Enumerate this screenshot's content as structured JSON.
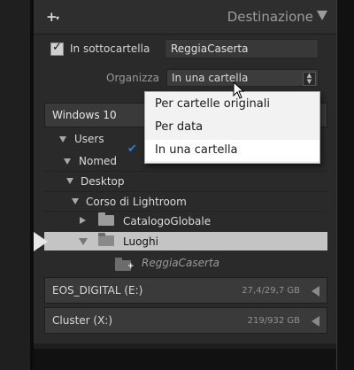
{
  "header": {
    "title": "Destinazione",
    "add_icon": "plus-icon",
    "collapse_icon": "triangle-down-icon"
  },
  "subfolder": {
    "label": "In sottocartella",
    "checked": true,
    "value": "ReggiaCaserta"
  },
  "organize": {
    "label": "Organizza",
    "value": "In una cartella"
  },
  "dropdown": {
    "items": [
      {
        "label": "Per cartelle originali",
        "selected": false
      },
      {
        "label": "Per data",
        "selected": false
      },
      {
        "label": "In una cartella",
        "selected": true
      }
    ],
    "check_color": "#2c7fd6"
  },
  "tree": {
    "volume_main": "Windows 10",
    "items": [
      {
        "label": "Users"
      },
      {
        "label": "Nomed"
      },
      {
        "label": "Desktop"
      },
      {
        "label": "Corso di Lightroom"
      },
      {
        "label": "CatalogoGlobale"
      },
      {
        "label": "Luoghi"
      },
      {
        "label": "ReggiaCaserta"
      }
    ]
  },
  "volumes": [
    {
      "name": "EOS_DIGITAL (E:)",
      "size": "27,4/29,7 GB"
    },
    {
      "name": "Cluster (X:)",
      "size": "219/932 GB"
    }
  ],
  "colors": {
    "panel": "#2a2a2a",
    "selected_row": "#c4c4c4",
    "menu_bg": "#f2f2f2"
  }
}
